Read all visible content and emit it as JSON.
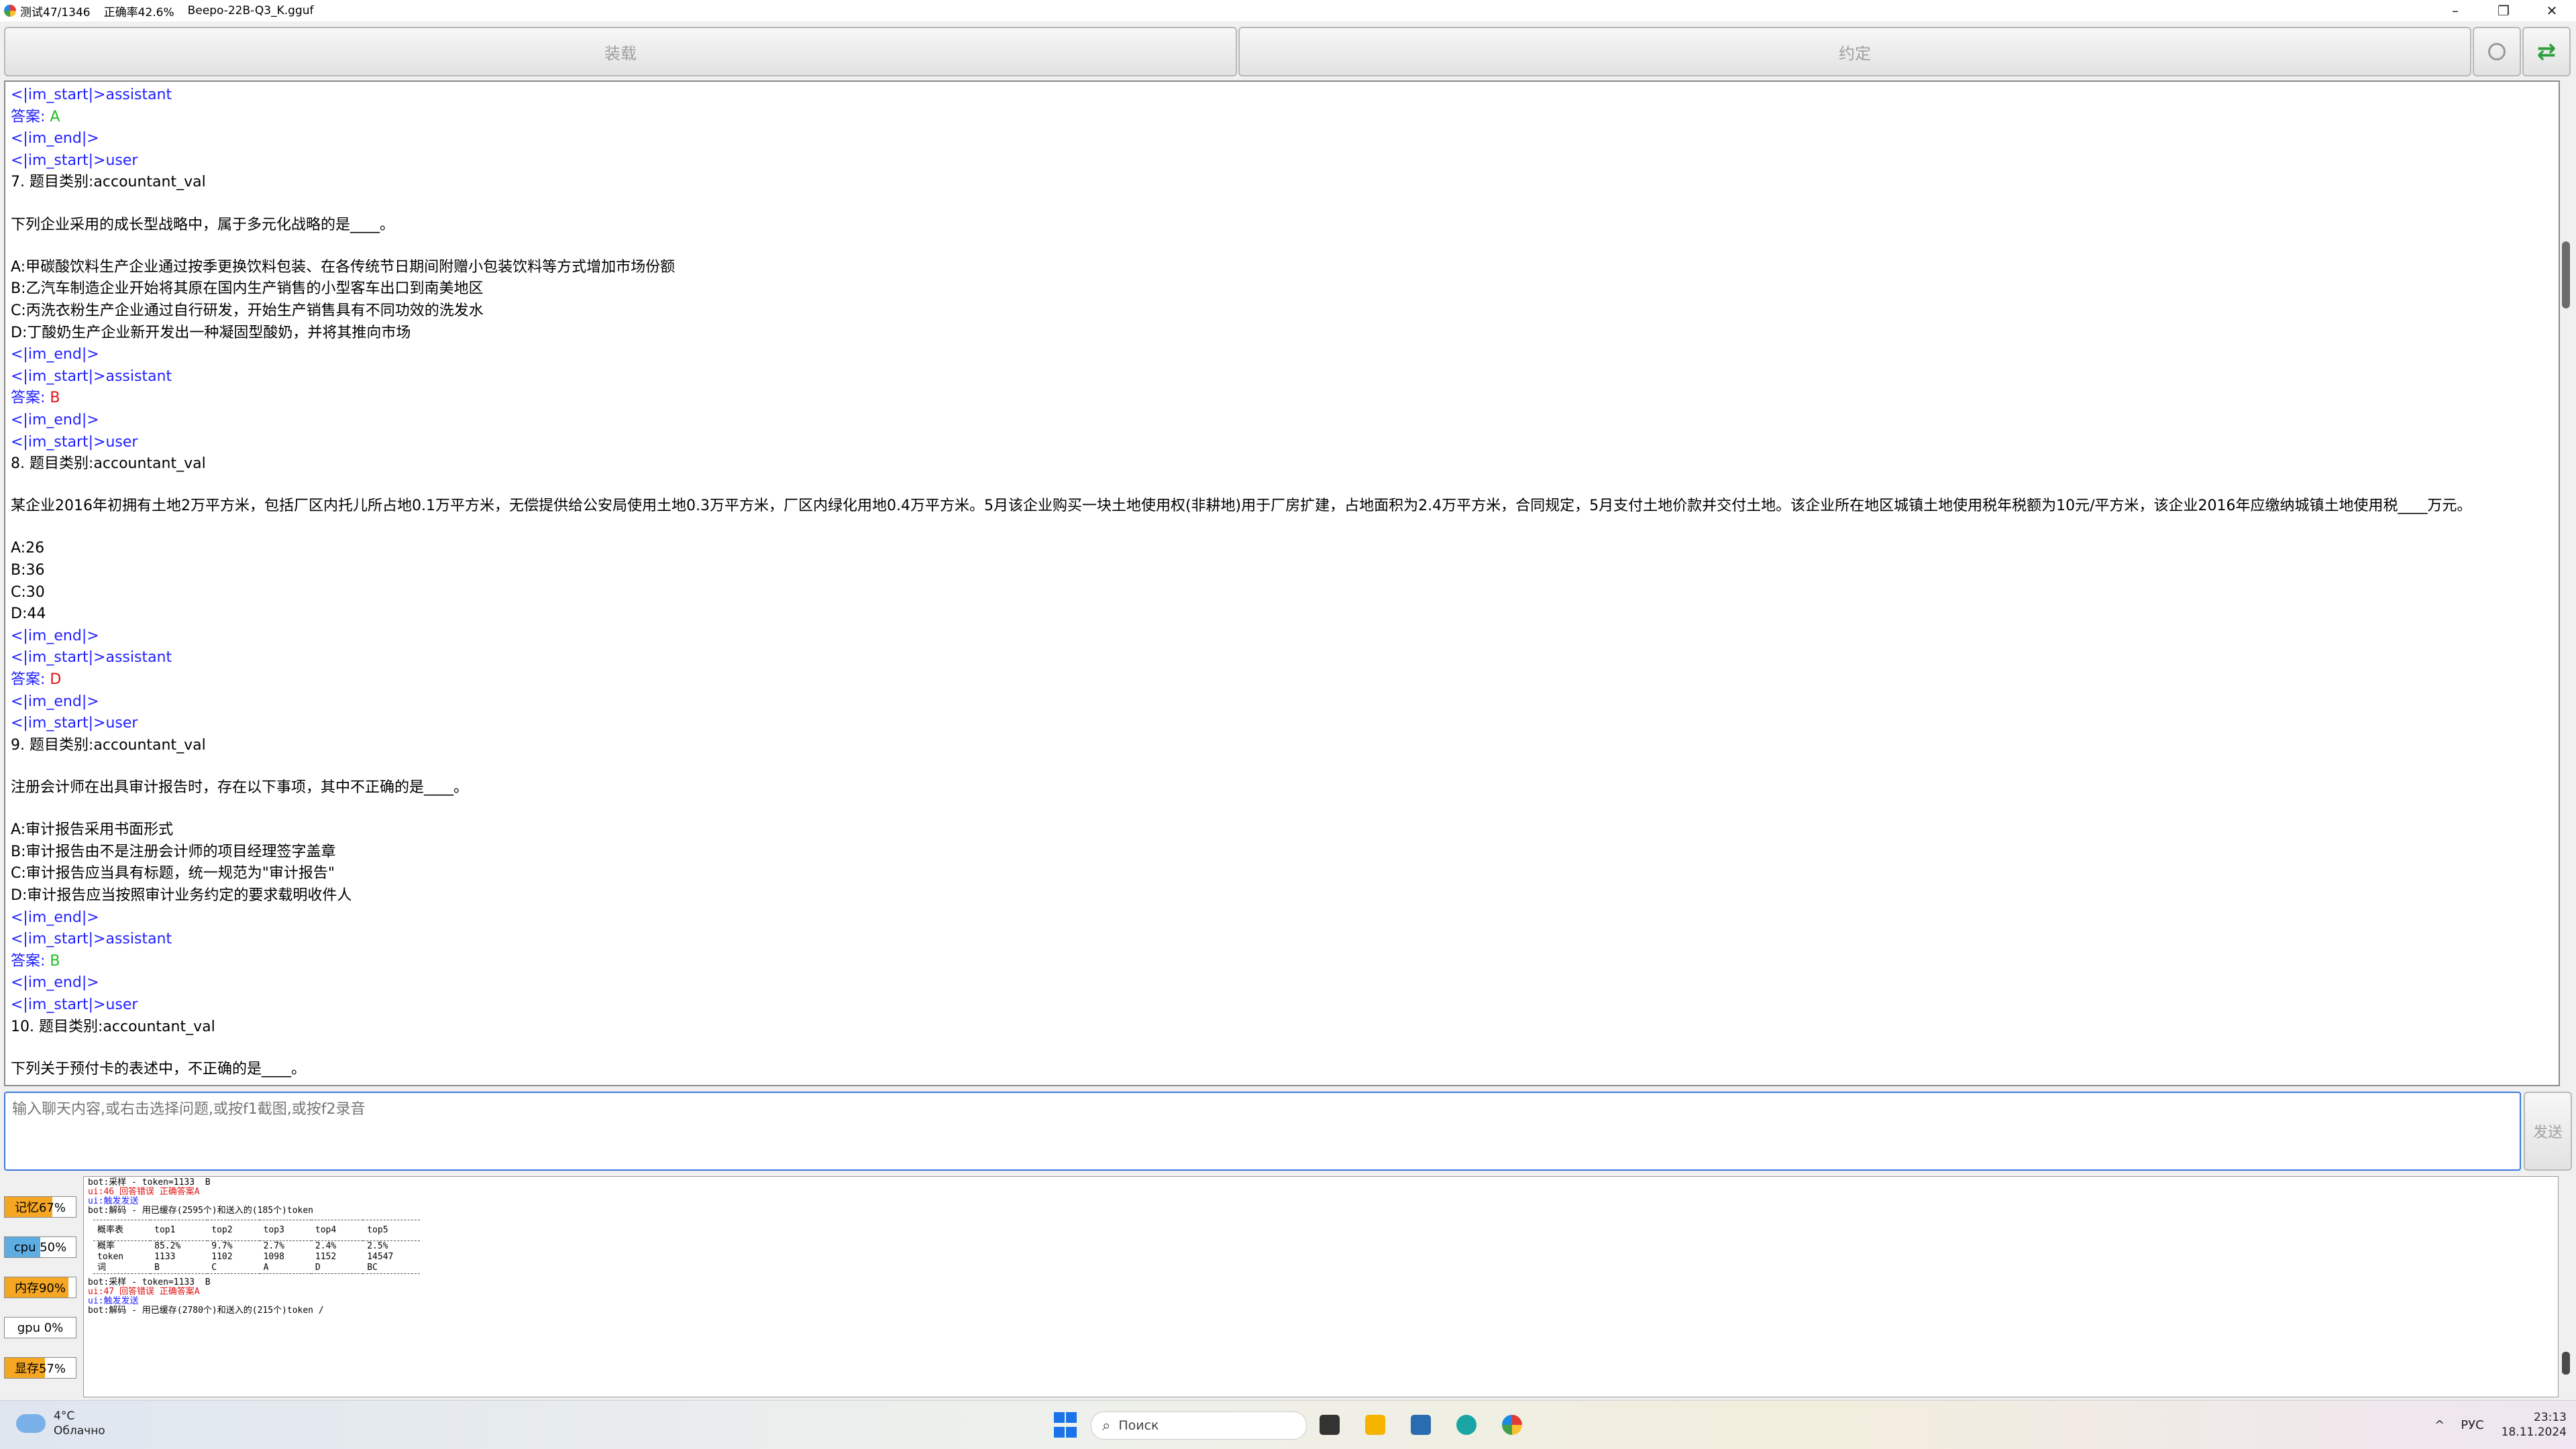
{
  "window": {
    "progress": "测试47/1346",
    "accuracy": "正确率42.6%",
    "model": "Beepo-22B-Q3_K.gguf",
    "minimize": "–",
    "restore": "❐",
    "close": "✕"
  },
  "toolbar": {
    "load_label": "装载",
    "agreement_label": "约定",
    "refresh_glyph": "⇄"
  },
  "transcript": {
    "lines": [
      {
        "kind": "tag",
        "text": "<|im_start|>assistant"
      },
      {
        "kind": "answer",
        "prefix": "答案: ",
        "value": "A",
        "color": "green"
      },
      {
        "kind": "tag",
        "text": "<|im_end|>"
      },
      {
        "kind": "tag",
        "text": "<|im_start|>user"
      },
      {
        "kind": "text",
        "text": "7. 题目类别:accountant_val"
      },
      {
        "kind": "blank",
        "text": ""
      },
      {
        "kind": "text",
        "text": "下列企业采用的成长型战略中，属于多元化战略的是____。"
      },
      {
        "kind": "blank",
        "text": ""
      },
      {
        "kind": "text",
        "text": "A:甲碳酸饮料生产企业通过按季更换饮料包装、在各传统节日期间附赠小包装饮料等方式增加市场份额"
      },
      {
        "kind": "text",
        "text": "B:乙汽车制造企业开始将其原在国内生产销售的小型客车出口到南美地区"
      },
      {
        "kind": "text",
        "text": "C:丙洗衣粉生产企业通过自行研发，开始生产销售具有不同功效的洗发水"
      },
      {
        "kind": "text",
        "text": "D:丁酸奶生产企业新开发出一种凝固型酸奶，并将其推向市场"
      },
      {
        "kind": "tag",
        "text": "<|im_end|>"
      },
      {
        "kind": "tag",
        "text": "<|im_start|>assistant"
      },
      {
        "kind": "answer",
        "prefix": "答案: ",
        "value": "B",
        "color": "red"
      },
      {
        "kind": "tag",
        "text": "<|im_end|>"
      },
      {
        "kind": "tag",
        "text": "<|im_start|>user"
      },
      {
        "kind": "text",
        "text": "8. 题目类别:accountant_val"
      },
      {
        "kind": "blank",
        "text": ""
      },
      {
        "kind": "text",
        "text": "某企业2016年初拥有土地2万平方米，包括厂区内托儿所占地0.1万平方米，无偿提供给公安局使用土地0.3万平方米，厂区内绿化用地0.4万平方米。5月该企业购买一块土地使用权(非耕地)用于厂房扩建，占地面积为2.4万平方米，合同规定，5月支付土地价款并交付土地。该企业所在地区城镇土地使用税年税额为10元/平方米，该企业2016年应缴纳城镇土地使用税____万元。"
      },
      {
        "kind": "blank",
        "text": ""
      },
      {
        "kind": "text",
        "text": "A:26"
      },
      {
        "kind": "text",
        "text": "B:36"
      },
      {
        "kind": "text",
        "text": "C:30"
      },
      {
        "kind": "text",
        "text": "D:44"
      },
      {
        "kind": "tag",
        "text": "<|im_end|>"
      },
      {
        "kind": "tag",
        "text": "<|im_start|>assistant"
      },
      {
        "kind": "answer",
        "prefix": "答案: ",
        "value": "D",
        "color": "red"
      },
      {
        "kind": "tag",
        "text": "<|im_end|>"
      },
      {
        "kind": "tag",
        "text": "<|im_start|>user"
      },
      {
        "kind": "text",
        "text": "9. 题目类别:accountant_val"
      },
      {
        "kind": "blank",
        "text": ""
      },
      {
        "kind": "text",
        "text": "注册会计师在出具审计报告时，存在以下事项，其中不正确的是____。"
      },
      {
        "kind": "blank",
        "text": ""
      },
      {
        "kind": "text",
        "text": "A:审计报告采用书面形式"
      },
      {
        "kind": "text",
        "text": "B:审计报告由不是注册会计师的项目经理签字盖章"
      },
      {
        "kind": "text",
        "text": "C:审计报告应当具有标题，统一规范为\"审计报告\""
      },
      {
        "kind": "text",
        "text": "D:审计报告应当按照审计业务约定的要求载明收件人"
      },
      {
        "kind": "tag",
        "text": "<|im_end|>"
      },
      {
        "kind": "tag",
        "text": "<|im_start|>assistant"
      },
      {
        "kind": "answer",
        "prefix": "答案: ",
        "value": "B",
        "color": "green"
      },
      {
        "kind": "tag",
        "text": "<|im_end|>"
      },
      {
        "kind": "tag",
        "text": "<|im_start|>user"
      },
      {
        "kind": "text",
        "text": "10. 题目类别:accountant_val"
      },
      {
        "kind": "blank",
        "text": ""
      },
      {
        "kind": "text",
        "text": "下列关于预付卡的表述中，不正确的是____。"
      }
    ]
  },
  "input": {
    "placeholder": "输入聊天内容,或右击选择问题,或按f1截图,或按f2录音",
    "send_label": "发送"
  },
  "stats": {
    "memory": {
      "label": "记忆67%",
      "level": 0.67,
      "color": "#f5a623"
    },
    "cpu": {
      "label": "cpu 50%",
      "level": 0.5,
      "color": "#5dade2"
    },
    "ram": {
      "label": "内存90%",
      "level": 0.9,
      "color": "#f5a623"
    },
    "gpu": {
      "label": "gpu 0%",
      "level": 0.0,
      "color": "#5dade2"
    },
    "vram": {
      "label": "显存57%",
      "level": 0.57,
      "color": "#f5a623"
    }
  },
  "log": {
    "block1": [
      {
        "text": "bot:采样 - token=1133  B",
        "color": "black"
      },
      {
        "text": "ui:46 回答错误 正确答案A",
        "color": "red"
      },
      {
        "text": "ui:触发发送",
        "color": "blue"
      },
      {
        "text": "bot:解码 - 用已缓存(2595个)和送入的(185个)token",
        "color": "black"
      }
    ],
    "table": {
      "headers": [
        "概率表",
        "top1",
        "top2",
        "top3",
        "top4",
        "top5"
      ],
      "rows": [
        [
          "概率",
          "85.2%",
          "9.7%",
          "2.7%",
          "2.4%",
          "2.5%"
        ],
        [
          "token",
          "1133",
          "1102",
          "1098",
          "1152",
          "14547"
        ],
        [
          "词",
          "B",
          "C",
          "A",
          "D",
          "BC"
        ]
      ]
    },
    "block2": [
      {
        "text": "bot:采样 - token=1133  B",
        "color": "black"
      },
      {
        "text": "ui:47 回答错误 正确答案A",
        "color": "red"
      },
      {
        "text": "ui:触发发送",
        "color": "blue"
      },
      {
        "text": "bot:解码 - 用已缓存(2780个)和送入的(215个)token /",
        "color": "black"
      }
    ]
  },
  "taskbar": {
    "temp": "4°C",
    "condition": "Облачно",
    "search_placeholder": "Поиск",
    "lang": "РУС",
    "time": "23:13",
    "date": "18.11.2024",
    "chevron": "^",
    "icons": [
      "start-icon",
      "search-icon",
      "task-view-icon",
      "file-explorer-icon",
      "store-icon",
      "edge-icon",
      "app-icon"
    ]
  }
}
